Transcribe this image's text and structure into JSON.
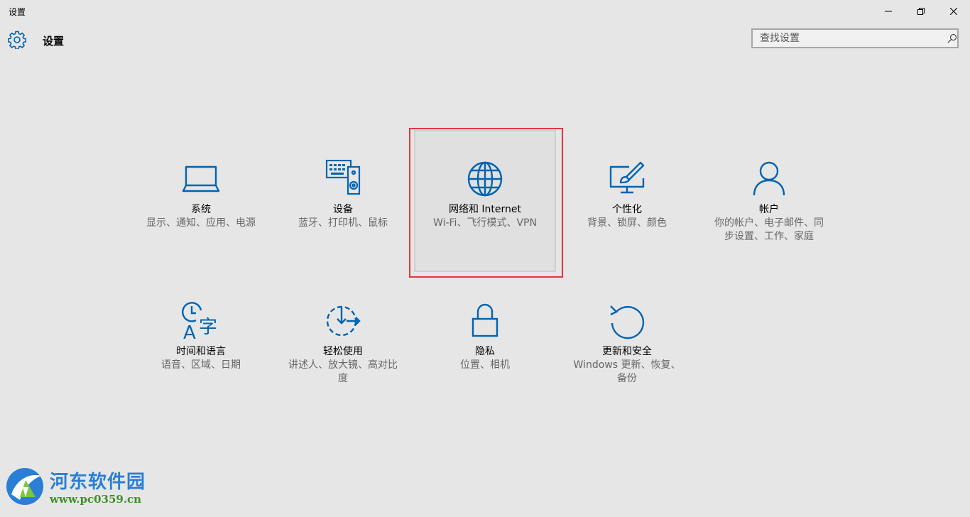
{
  "window": {
    "title": "设置"
  },
  "header": {
    "title": "设置"
  },
  "search": {
    "placeholder": "查找设置",
    "value": ""
  },
  "tiles": [
    {
      "title": "系统",
      "desc": "显示、通知、应用、电源",
      "icon": "laptop-icon"
    },
    {
      "title": "设备",
      "desc": "蓝牙、打印机、鼠标",
      "icon": "devices-icon"
    },
    {
      "title": "网络和 Internet",
      "desc": "Wi-Fi、飞行模式、VPN",
      "icon": "globe-icon"
    },
    {
      "title": "个性化",
      "desc": "背景、锁屏、颜色",
      "icon": "personalize-icon"
    },
    {
      "title": "帐户",
      "desc": "你的帐户、电子邮件、同步设置、工作、家庭",
      "icon": "person-icon"
    },
    {
      "title": "时间和语言",
      "desc": "语音、区域、日期",
      "icon": "time-language-icon"
    },
    {
      "title": "轻松使用",
      "desc": "讲述人、放大镜、高对比度",
      "icon": "ease-of-access-icon"
    },
    {
      "title": "隐私",
      "desc": "位置、相机",
      "icon": "lock-icon"
    },
    {
      "title": "更新和安全",
      "desc": "Windows 更新、恢复、备份",
      "icon": "update-icon"
    }
  ],
  "colors": {
    "accent": "#0063b1",
    "background": "#e6e6e6",
    "highlight": "#e0383e"
  },
  "watermark": {
    "name": "河东软件园",
    "url": "www.pc0359.cn"
  }
}
